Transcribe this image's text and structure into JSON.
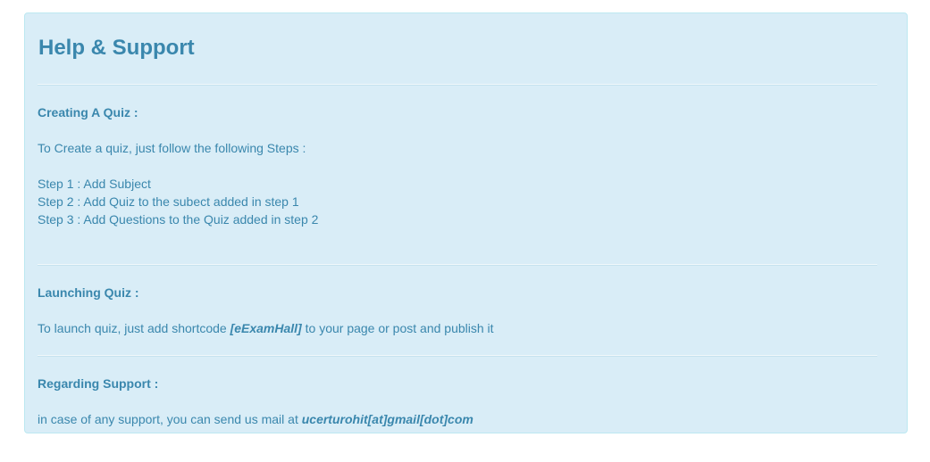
{
  "panel": {
    "title": "Help & Support",
    "sections": {
      "create": {
        "heading": "Creating A Quiz :",
        "intro": "To Create a quiz, just follow the following Steps :",
        "steps": [
          "Step 1 : Add Subject",
          "Step 2 : Add Quiz to the subect added in step 1",
          "Step 3 : Add Questions to the Quiz added in step 2"
        ]
      },
      "launch": {
        "heading": "Launching Quiz :",
        "text_before": "To launch quiz, just add shortcode ",
        "shortcode": "[eExamHall]",
        "text_after": " to your page or post and publish it"
      },
      "support": {
        "heading": "Regarding Support :",
        "text_before": "in case of any support, you can send us mail at ",
        "email": "ucerturohit[at]gmail[dot]com"
      }
    }
  }
}
